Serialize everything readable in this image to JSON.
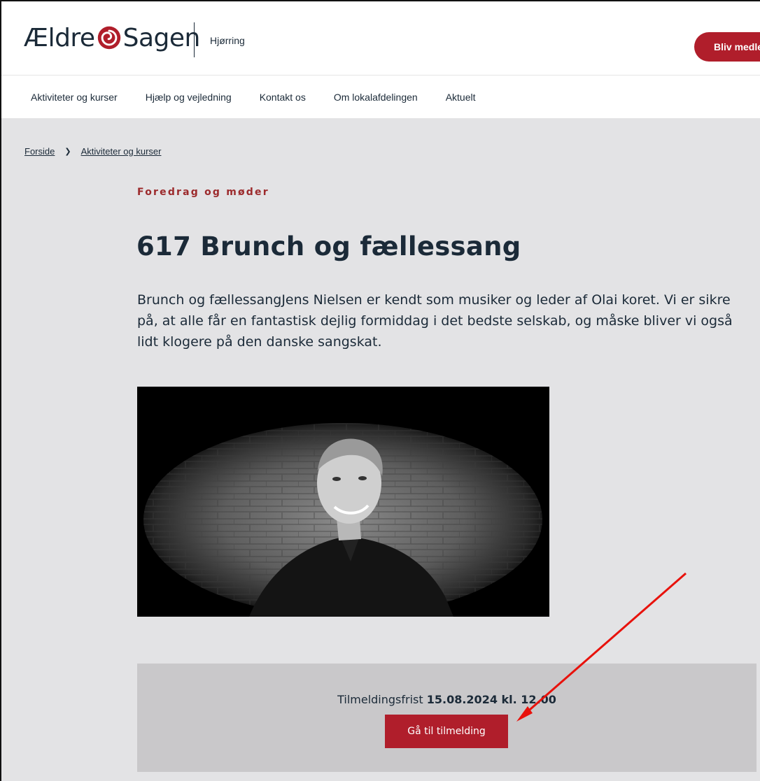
{
  "header": {
    "logo_text_left": "Ældre",
    "logo_text_right": "Sagen",
    "branch": "Hjørring",
    "member_button": "Bliv medle"
  },
  "nav": {
    "items": [
      "Aktiviteter og kurser",
      "Hjælp og vejledning",
      "Kontakt os",
      "Om lokalafdelingen",
      "Aktuelt"
    ]
  },
  "breadcrumb": {
    "items": [
      "Forside",
      "Aktiviteter og kurser"
    ]
  },
  "event": {
    "category": "Foredrag og møder",
    "title": "617 Brunch og fællessang",
    "description": "Brunch og fællessangJens Nielsen er kendt som musiker og leder af Olai koret. Vi er sikre på, at alle får en fantastisk dejlig formiddag i det bedste selskab, og måske bliver vi også lidt klogere på den danske sangskat."
  },
  "signup": {
    "deadline_label": "Tilmeldingsfrist",
    "deadline_value": "15.08.2024 kl. 12.00",
    "button": "Gå til tilmelding"
  },
  "colors": {
    "brand_red": "#b01e2b",
    "category_red": "#9c2a2c",
    "text_dark": "#1b2a38",
    "page_bg": "#e3e3e5",
    "signup_bg": "#c9c8ca",
    "annotation_arrow": "#e8120c"
  },
  "icons": {
    "logo_mark": "swirl-logo-icon",
    "breadcrumb_separator": "chevron-right-icon"
  }
}
